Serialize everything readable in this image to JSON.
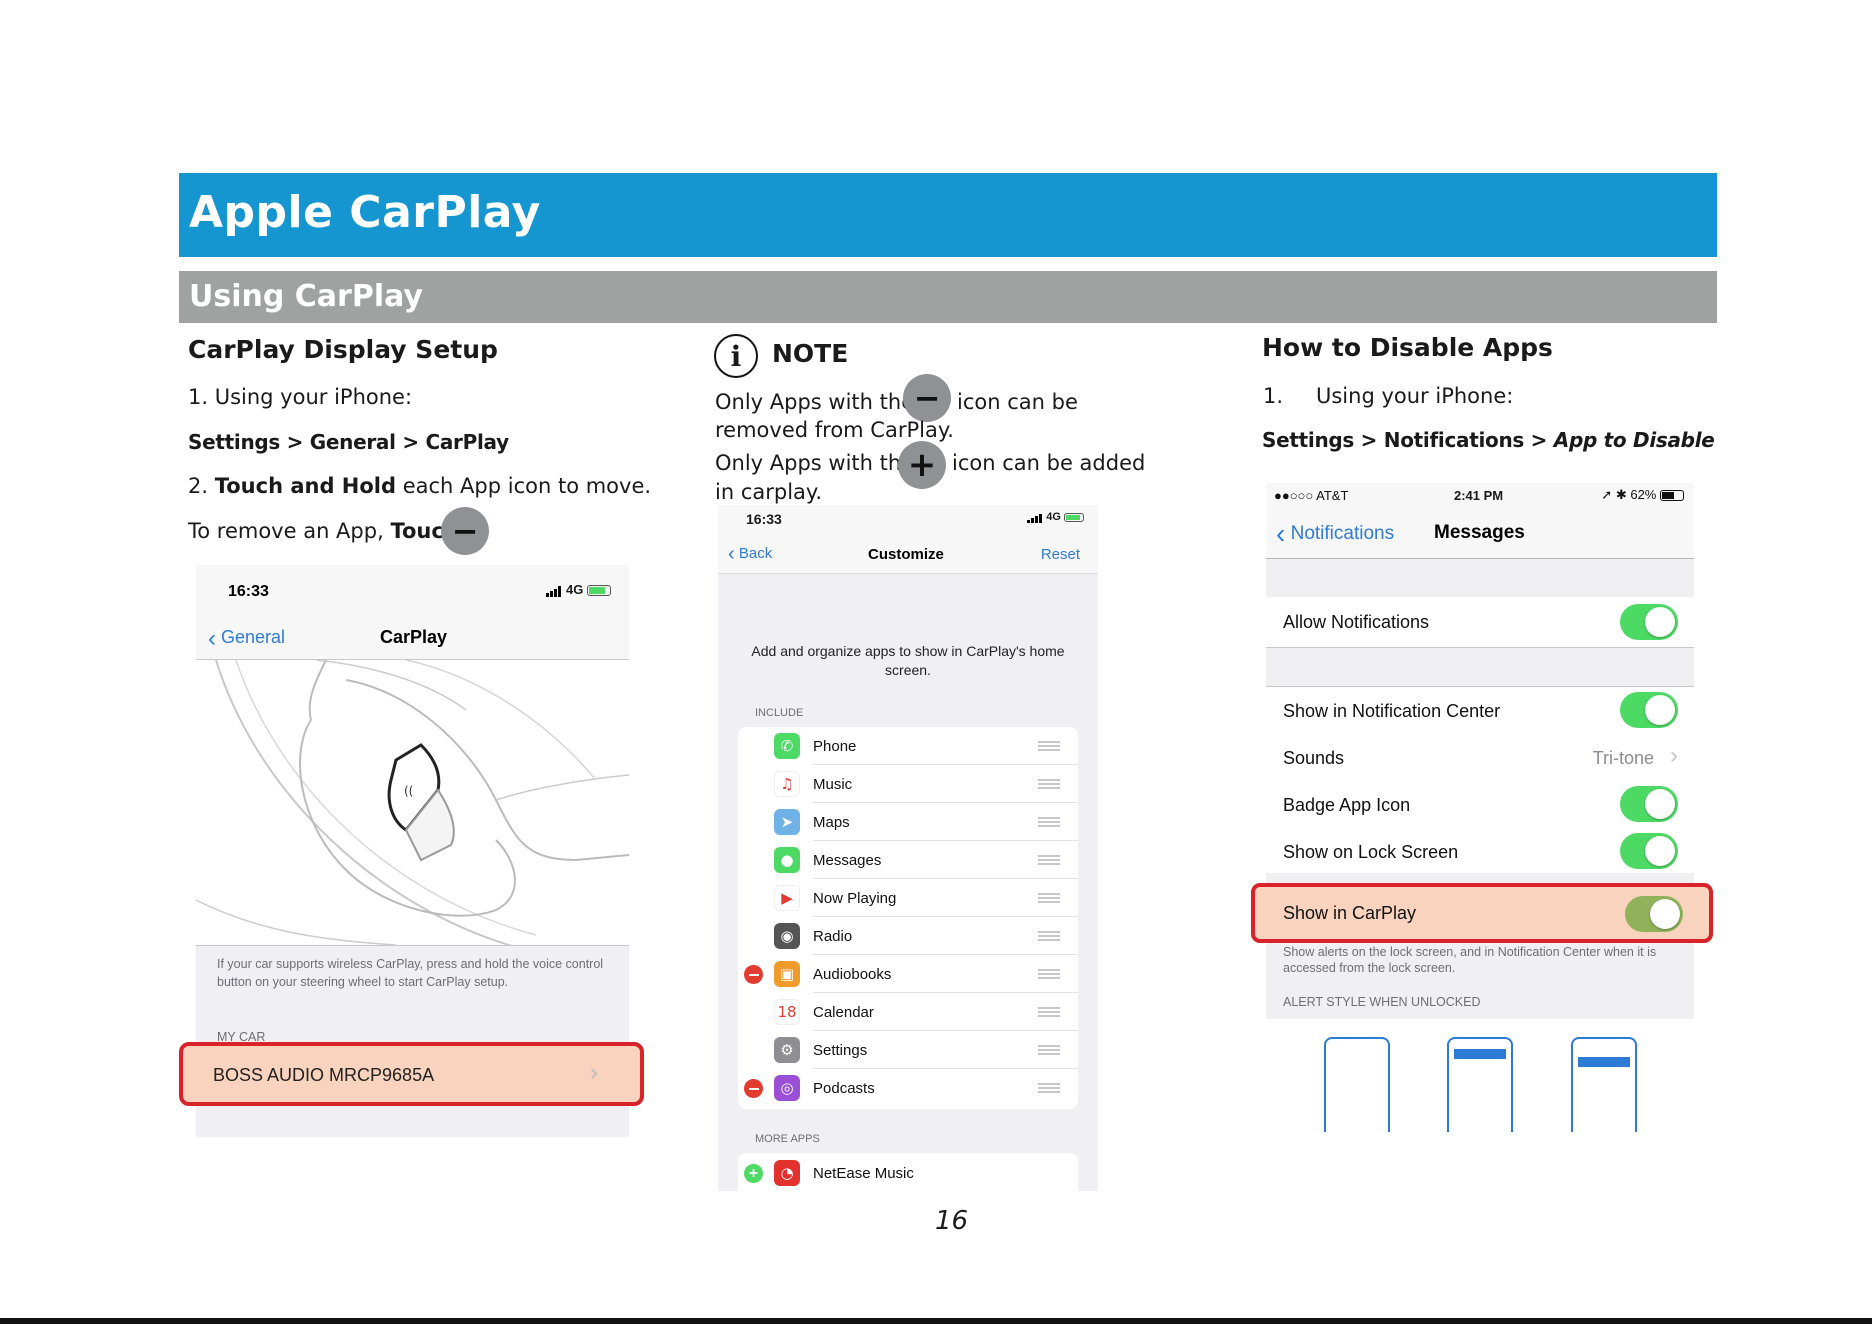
{
  "header": {
    "title": "Apple CarPlay",
    "section": "Using CarPlay"
  },
  "col1": {
    "heading": "CarPlay Display Setup",
    "step1": "1.  Using your iPhone:",
    "path": "Settings > General > CarPlay",
    "step2_num": "2. ",
    "step2_bold": "Touch and Hold",
    "step2_rest": " each App icon to move.",
    "remove_text": "To remove an App, ",
    "remove_bold": "Touch",
    "phone": {
      "time": "16:33",
      "network": "4G",
      "back": "General",
      "title": "CarPlay",
      "hint": "If your car supports wireless CarPlay, press and hold the voice control button on your steering wheel to start CarPlay setup.",
      "my_car": "MY CAR",
      "car_name": "BOSS AUDIO  MRCP9685A",
      "chevron": "›"
    }
  },
  "col2": {
    "note_icon": "i",
    "note_title": "NOTE",
    "line1_a": "Only Apps with the",
    "line1_b": "icon can be",
    "line1_c": "removed from CarPlay.",
    "line2_a": "Only Apps with the",
    "line2_b": "icon can be added",
    "line2_c": "in carplay.",
    "phone": {
      "time": "16:33",
      "network": "4G",
      "back": "Back",
      "title": "Customize",
      "reset": "Reset",
      "description": "Add and organize apps to show in CarPlay's home screen.",
      "include_label": "INCLUDE",
      "apps": [
        {
          "name": "Phone",
          "icon": "phone-icon",
          "color": "#4cd964",
          "glyph": "✆",
          "removable": false
        },
        {
          "name": "Music",
          "icon": "music-icon",
          "color": "#ffffff",
          "glyph": "♫",
          "removable": false
        },
        {
          "name": "Maps",
          "icon": "maps-icon",
          "color": "#6fb2e8",
          "glyph": "➤",
          "removable": false
        },
        {
          "name": "Messages",
          "icon": "messages-icon",
          "color": "#4cd964",
          "glyph": "●",
          "removable": false
        },
        {
          "name": "Now Playing",
          "icon": "now-playing-icon",
          "color": "#ffffff",
          "glyph": "▶",
          "removable": false
        },
        {
          "name": "Radio",
          "icon": "radio-icon",
          "color": "#555555",
          "glyph": "◉",
          "removable": false
        },
        {
          "name": "Audiobooks",
          "icon": "audiobooks-icon",
          "color": "#f09a2a",
          "glyph": "▣",
          "removable": true
        },
        {
          "name": "Calendar",
          "icon": "calendar-icon",
          "color": "#ffffff",
          "glyph": "18",
          "removable": false
        },
        {
          "name": "Settings",
          "icon": "settings-icon",
          "color": "#8e8e93",
          "glyph": "⚙",
          "removable": false
        },
        {
          "name": "Podcasts",
          "icon": "podcasts-icon",
          "color": "#9a4fd6",
          "glyph": "◎",
          "removable": true
        }
      ],
      "more_label": "MORE APPS",
      "more_apps": [
        {
          "name": "NetEase Music",
          "icon": "netease-music-icon",
          "color": "#e3312d",
          "glyph": "◔"
        }
      ]
    }
  },
  "col3": {
    "heading": "How to Disable Apps",
    "step1_num": "1.",
    "step1": "Using your iPhone:",
    "path_bold": "Settings > Notifications > ",
    "path_italic": "App to Disable",
    "phone": {
      "carrier": "●●○○○ AT&T",
      "time": "2:41 PM",
      "battery": "62%",
      "back": "Notifications",
      "title": "Messages",
      "allow": "Allow Notifications",
      "rows": [
        {
          "label": "Show in Notification Center",
          "type": "toggle"
        },
        {
          "label": "Sounds",
          "type": "value",
          "value": "Tri-tone"
        },
        {
          "label": "Badge App Icon",
          "type": "toggle"
        },
        {
          "label": "Show on Lock Screen",
          "type": "toggle"
        }
      ],
      "carplay": "Show in CarPlay",
      "footer": "Show alerts on the lock screen, and in Notification Center when it is accessed from the lock screen.",
      "alert_style": "ALERT STYLE WHEN UNLOCKED",
      "chevron": "›"
    }
  },
  "page_number": "16",
  "colors": {
    "title_bar": "#1596d0",
    "section_bar": "#a0a1a1",
    "highlight": "#f9d3bd",
    "highlight_border": "#d8232a",
    "toggle_on": "#4cd964",
    "ios_blue": "#2e7bd6"
  }
}
